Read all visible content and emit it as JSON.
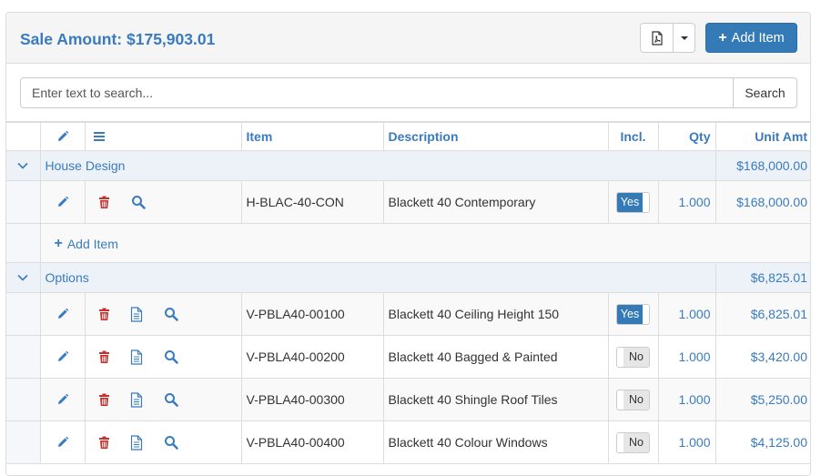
{
  "header": {
    "sale_amount": "Sale Amount: $175,903.01",
    "pdf_icon": "pdf-file-icon",
    "add_item_label": "Add Item"
  },
  "search": {
    "placeholder": "Enter text to search...",
    "button_label": "Search"
  },
  "table": {
    "columns": {
      "edit_icon": "pencil-icon",
      "menu_icon": "list-icon",
      "item": "Item",
      "description": "Description",
      "incl": "Incl.",
      "qty": "Qty",
      "unit_amt": "Unit Amt"
    },
    "groups": [
      {
        "label": "House Design",
        "total": "$168,000.00",
        "rows": [
          {
            "item": "H-BLAC-40-CON",
            "description": "Blackett 40 Contemporary",
            "incl": "Yes",
            "qty": "1.000",
            "unit_amt": "$168,000.00"
          }
        ],
        "add_item_label": "Add Item"
      },
      {
        "label": "Options",
        "total": "$6,825.01",
        "rows": [
          {
            "item": "V-PBLA40-00100",
            "description": "Blackett 40 Ceiling Height 150",
            "incl": "Yes",
            "qty": "1.000",
            "unit_amt": "$6,825.01"
          },
          {
            "item": "V-PBLA40-00200",
            "description": "Blackett 40 Bagged & Painted",
            "incl": "No",
            "qty": "1.000",
            "unit_amt": "$3,420.00"
          },
          {
            "item": "V-PBLA40-00300",
            "description": "Blackett 40 Shingle Roof Tiles",
            "incl": "No",
            "qty": "1.000",
            "unit_amt": "$5,250.00"
          },
          {
            "item": "V-PBLA40-00400",
            "description": "Blackett 40 Colour Windows",
            "incl": "No",
            "qty": "1.000",
            "unit_amt": "$4,125.00"
          }
        ]
      }
    ]
  },
  "colors": {
    "accent": "#3a7bbf",
    "primary_button": "#337ab7",
    "delete_icon": "#c9302c",
    "group_row_bg": "#edf2f8"
  }
}
